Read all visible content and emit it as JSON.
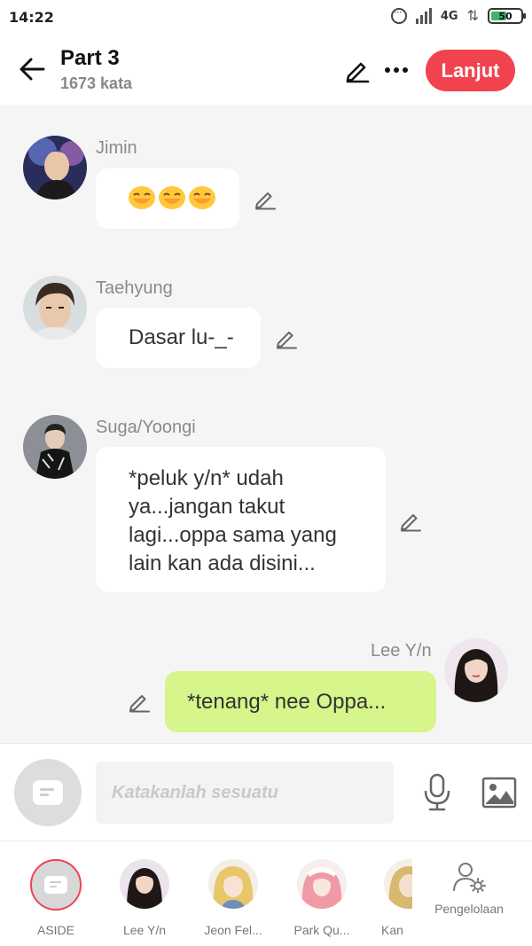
{
  "status_bar": {
    "time": "14:22",
    "network": "4G",
    "battery": "50"
  },
  "header": {
    "title": "Part 3",
    "word_count": "1673 kata",
    "next_label": "Lanjut",
    "accent_color": "#f0434f"
  },
  "messages": [
    {
      "sender": "Jimin",
      "text": "",
      "emojis": 3,
      "side": "left"
    },
    {
      "sender": "Taehyung",
      "text": "Dasar lu-_-",
      "side": "left"
    },
    {
      "sender": "Suga/Yoongi",
      "lines": [
        "*peluk y/n* udah",
        "ya...jangan takut",
        "lagi...oppa sama yang",
        "lain kan ada disini..."
      ],
      "side": "left"
    },
    {
      "sender": "Lee Y/n",
      "text": "*tenang* nee Oppa...",
      "side": "right",
      "bubble_color": "#d6f58a"
    }
  ],
  "input": {
    "placeholder": "Katakanlah sesuatu"
  },
  "characters": [
    {
      "label": "ASIDE"
    },
    {
      "label": "Lee Y/n"
    },
    {
      "label": "Jeon Fel..."
    },
    {
      "label": "Park Qu..."
    },
    {
      "label": "Kan"
    }
  ],
  "manage_label": "Pengelolaan"
}
